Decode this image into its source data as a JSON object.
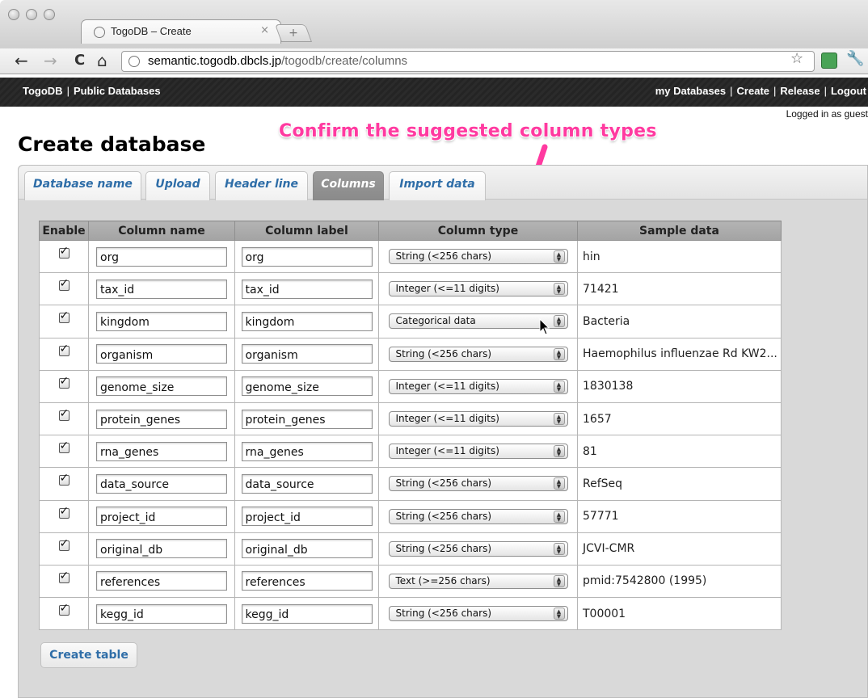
{
  "browser": {
    "tab_title": "TogoDB – Create",
    "tab_close": "×",
    "new_tab": "+",
    "back": "←",
    "forward": "→",
    "reload": "C",
    "home": "⌂",
    "url_host": "semantic.togodb.dbcls.jp",
    "url_path": "/togodb/create/columns",
    "star": "☆",
    "wrench": "🔧"
  },
  "site": {
    "brand": "TogoDB",
    "public_link": "Public Databases",
    "separator": "|",
    "nav": [
      "my Databases",
      "Create",
      "Release",
      "Logout"
    ],
    "logged_in": "Logged in as guest"
  },
  "page": {
    "title": "Create database",
    "annotation": "Confirm the suggested column types",
    "tabs": [
      "Database name",
      "Upload",
      "Header line",
      "Columns",
      "Import data"
    ],
    "active_tab": "Columns",
    "create_button": "Create table"
  },
  "table": {
    "headers": [
      "Enable",
      "Column name",
      "Column label",
      "Column type",
      "Sample data"
    ],
    "rows": [
      {
        "name": "org",
        "label": "org",
        "type": "String (<256 chars)",
        "sample": "hin"
      },
      {
        "name": "tax_id",
        "label": "tax_id",
        "type": "Integer (<=11 digits)",
        "sample": "71421"
      },
      {
        "name": "kingdom",
        "label": "kingdom",
        "type": "Categorical data",
        "sample": "Bacteria"
      },
      {
        "name": "organism",
        "label": "organism",
        "type": "String (<256 chars)",
        "sample": "Haemophilus influenzae Rd KW2..."
      },
      {
        "name": "genome_size",
        "label": "genome_size",
        "type": "Integer (<=11 digits)",
        "sample": "1830138"
      },
      {
        "name": "protein_genes",
        "label": "protein_genes",
        "type": "Integer (<=11 digits)",
        "sample": "1657"
      },
      {
        "name": "rna_genes",
        "label": "rna_genes",
        "type": "Integer (<=11 digits)",
        "sample": "81"
      },
      {
        "name": "data_source",
        "label": "data_source",
        "type": "String (<256 chars)",
        "sample": "RefSeq"
      },
      {
        "name": "project_id",
        "label": "project_id",
        "type": "String (<256 chars)",
        "sample": "57771"
      },
      {
        "name": "original_db",
        "label": "original_db",
        "type": "String (<256 chars)",
        "sample": "JCVI-CMR"
      },
      {
        "name": "references",
        "label": "references",
        "type": "Text (>=256 chars)",
        "sample": "pmid:7542800 (1995)"
      },
      {
        "name": "kegg_id",
        "label": "kegg_id",
        "type": "String (<256 chars)",
        "sample": "T00001"
      }
    ]
  },
  "colors": {
    "annotation": "#ff3aa0",
    "link_blue": "#2f6ea8",
    "header_bar": "#2b2b2b"
  }
}
